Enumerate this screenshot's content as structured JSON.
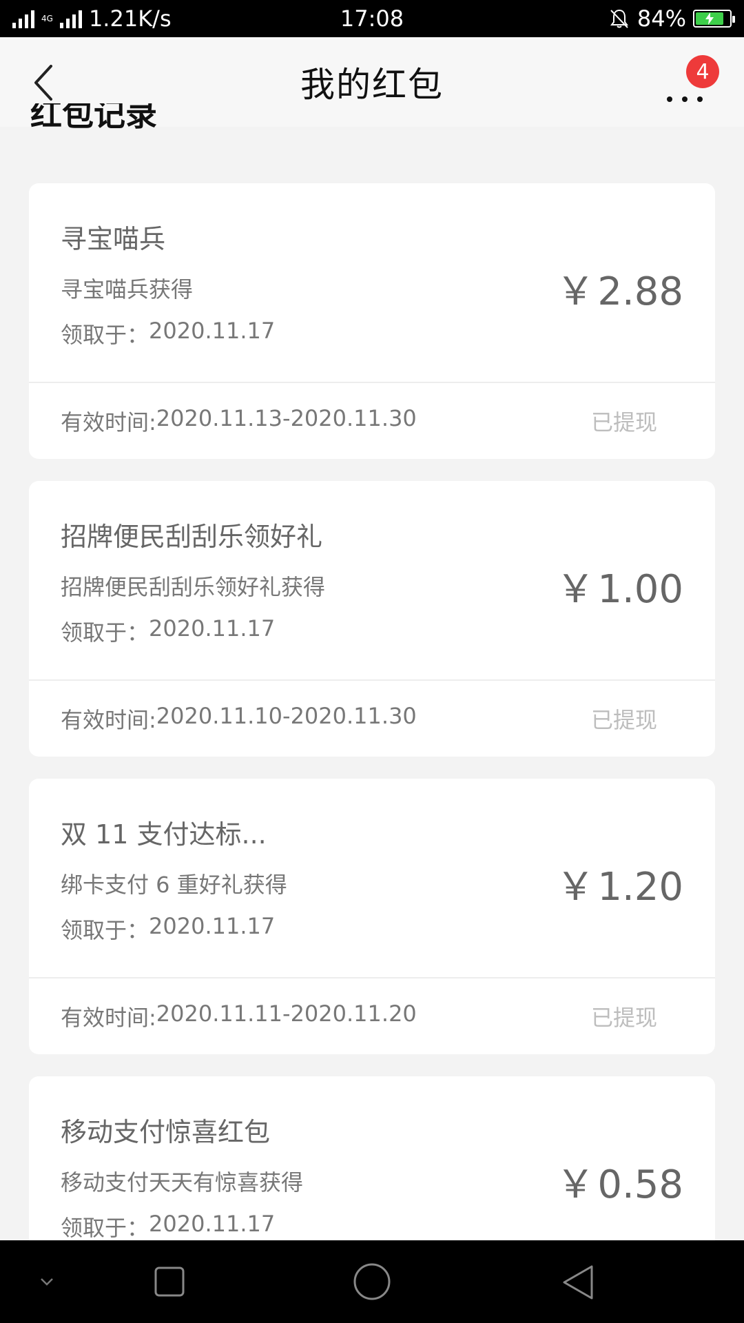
{
  "status_bar": {
    "network_type": "4G",
    "network_speed": "1.21K/s",
    "time": "17:08",
    "battery_percent": "84%",
    "battery_level": 0.84,
    "battery_color": "#3ecf4a"
  },
  "header": {
    "title": "我的红包",
    "badge_count": "4",
    "badge_color": "#ee3a3a"
  },
  "section_title": "红包记录",
  "cards": [
    {
      "name": "寻宝喵兵",
      "source": "寻宝喵兵获得",
      "received_label": "领取于：",
      "received_date": "2020.11.17",
      "currency": "￥",
      "amount": "2.88",
      "validity_label": "有效时间:",
      "validity": "2020.11.13-2020.11.30",
      "status": "已提现"
    },
    {
      "name": "招牌便民刮刮乐领好礼",
      "source": "招牌便民刮刮乐领好礼获得",
      "received_label": "领取于：",
      "received_date": "2020.11.17",
      "currency": "￥",
      "amount": "1.00",
      "validity_label": "有效时间:",
      "validity": "2020.11.10-2020.11.30",
      "status": "已提现"
    },
    {
      "name": "双 11 支付达标...",
      "source": "绑卡支付 6 重好礼获得",
      "received_label": "领取于：",
      "received_date": "2020.11.17",
      "currency": "￥",
      "amount": "1.20",
      "validity_label": "有效时间:",
      "validity": "2020.11.11-2020.11.20",
      "status": "已提现"
    },
    {
      "name": "移动支付惊喜红包",
      "source": "移动支付天天有惊喜获得",
      "received_label": "领取于：",
      "received_date": "2020.11.17",
      "currency": "￥",
      "amount": "0.58"
    }
  ]
}
